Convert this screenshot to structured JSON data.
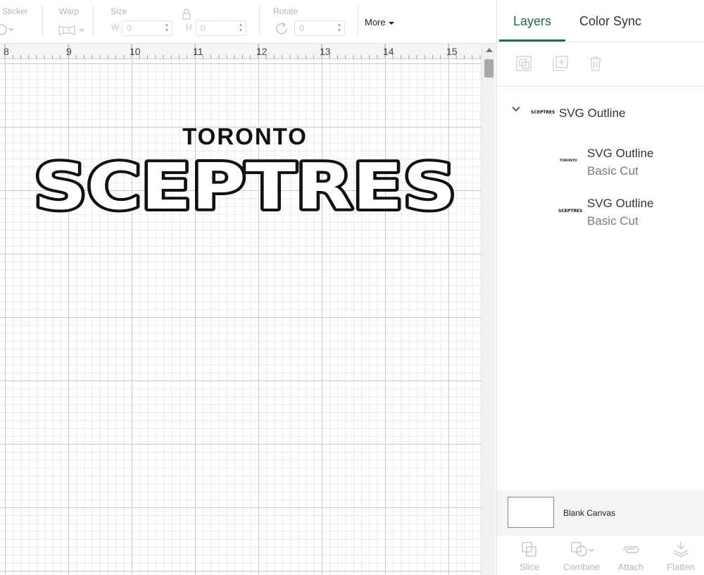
{
  "toolbar": {
    "sticker_label": "Sticker",
    "warp_label": "Warp",
    "size_label": "Size",
    "width_prefix": "W",
    "width_value": "0",
    "height_prefix": "H",
    "height_value": "0",
    "rotate_label": "Rotate",
    "rotate_value": "0",
    "more_label": "More"
  },
  "ruler": {
    "ticks": [
      "8",
      "9",
      "10",
      "11",
      "12",
      "13",
      "14",
      "15"
    ]
  },
  "canvas": {
    "line1": "TORONTO",
    "line2": "SCEPTRES"
  },
  "panel": {
    "tabs": [
      {
        "label": "Layers",
        "active": true
      },
      {
        "label": "Color Sync",
        "active": false
      }
    ],
    "layers": [
      {
        "title": "SVG Outline",
        "subtitle": "",
        "thumb": "SCEPTRES",
        "expanded": true
      },
      {
        "title": "SVG Outline",
        "subtitle": "Basic Cut",
        "thumb": "TORONTO"
      },
      {
        "title": "SVG Outline",
        "subtitle": "Basic Cut",
        "thumb": "SCEPTRES"
      }
    ],
    "blank_canvas_label": "Blank Canvas",
    "actions": [
      "Slice",
      "Combine",
      "Attach",
      "Flatten"
    ]
  },
  "colors": {
    "accent": "#1a6e48",
    "grid_major": "#c9c9c9",
    "grid_minor": "#e9e9e9",
    "disabled": "#b8b8b8"
  }
}
